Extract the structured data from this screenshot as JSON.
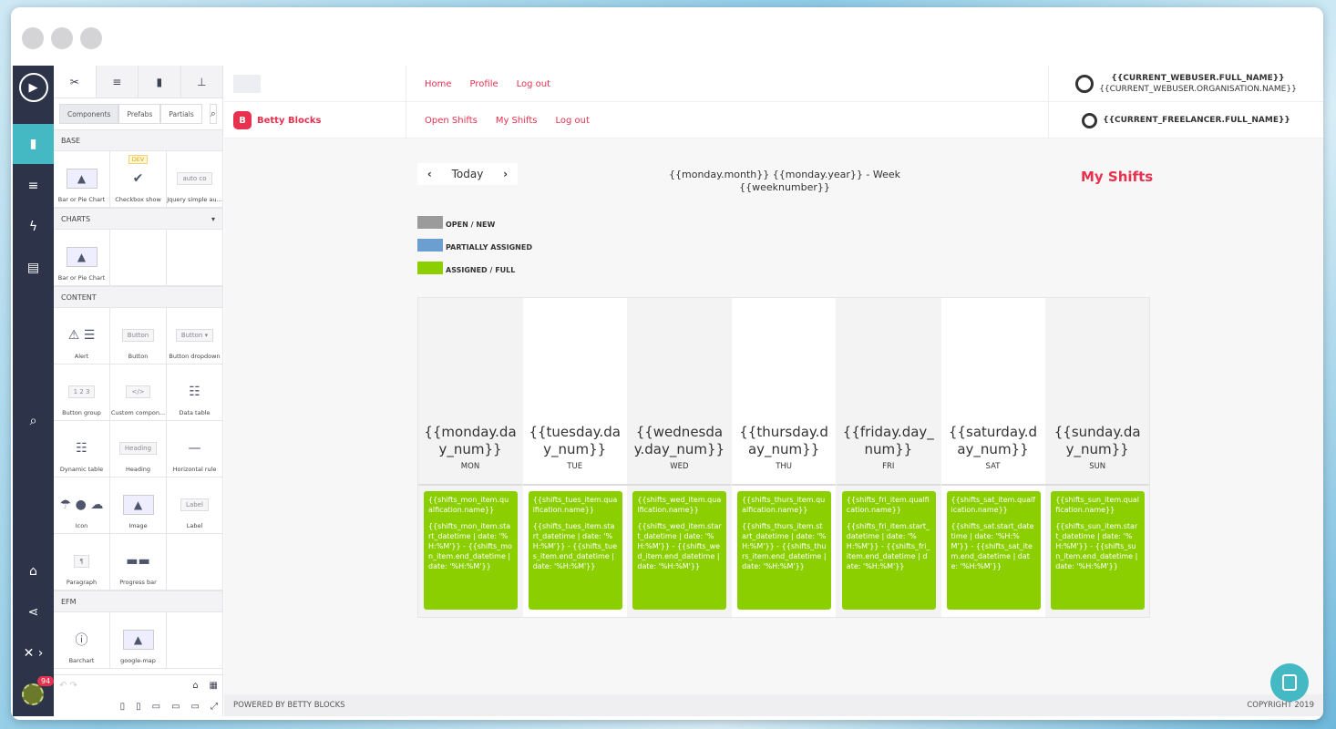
{
  "rail": {
    "icons": [
      "play-icon",
      "page-icon",
      "database-icon",
      "lightning-icon",
      "server-icon",
      "search-icon",
      "store-icon",
      "share-icon",
      "tools-icon"
    ],
    "notifications": "94"
  },
  "panel": {
    "segments": [
      "Components",
      "Prefabs",
      "Partials"
    ],
    "sections": [
      {
        "title": "BASE",
        "items": [
          {
            "label": "Bar or Pie Chart",
            "icon": "image-icon"
          },
          {
            "label": "Checkbox show",
            "icon": "checkbox-icon",
            "tag": "DEV"
          },
          {
            "label": "Jquery simple au...",
            "icon": "autocomplete-icon",
            "preview": "auto co"
          }
        ]
      },
      {
        "title": "CHARTS",
        "items": [
          {
            "label": "Bar or Pie Chart",
            "icon": "image-icon"
          }
        ]
      },
      {
        "title": "CONTENT",
        "items": [
          {
            "label": "Alert",
            "icon": "alert-icon"
          },
          {
            "label": "Button",
            "icon": "button-icon",
            "preview": "Button"
          },
          {
            "label": "Button dropdown",
            "icon": "button-dropdown-icon",
            "preview": "Button ▾"
          },
          {
            "label": "Button group",
            "icon": "button-group-icon",
            "preview": "1 2 3"
          },
          {
            "label": "Custom compon...",
            "icon": "code-icon",
            "preview": "</>"
          },
          {
            "label": "Data table",
            "icon": "table-icon"
          },
          {
            "label": "Dynamic table",
            "icon": "table-icon"
          },
          {
            "label": "Heading",
            "icon": "heading-icon",
            "preview": "Heading"
          },
          {
            "label": "Horizontal rule",
            "icon": "rule-icon"
          },
          {
            "label": "Icon",
            "icon": "icons-icon"
          },
          {
            "label": "Image",
            "icon": "image-icon"
          },
          {
            "label": "Label",
            "icon": "label-icon",
            "preview": "Label"
          },
          {
            "label": "Paragraph",
            "icon": "paragraph-icon",
            "preview": "¶"
          },
          {
            "label": "Progress bar",
            "icon": "progress-icon"
          }
        ]
      },
      {
        "title": "EFM",
        "items": [
          {
            "label": "Barchart",
            "icon": "info-icon"
          },
          {
            "label": "google-map",
            "icon": "image-icon"
          }
        ]
      }
    ]
  },
  "header": {
    "brand": "Betty Blocks",
    "nav1": [
      "Home",
      "Profile",
      "Log out"
    ],
    "nav2": [
      "Open Shifts",
      "My Shifts",
      "Log out"
    ],
    "webuser_name": "{{CURRENT_WEBUSER.FULL_NAME}}",
    "webuser_org": "{{CURRENT_WEBUSER.ORGANISATION.NAME}}",
    "freelancer_name": "{{CURRENT_FREELANCER.FULL_NAME}}"
  },
  "toolbar": {
    "today": "Today",
    "week_title": "{{monday.month}} {{monday.year}} - Week {{weeknumber}}",
    "page_title": "My Shifts"
  },
  "legend": [
    {
      "label": "OPEN / NEW",
      "color": "#9b9b9b"
    },
    {
      "label": "PARTIALLY ASSIGNED",
      "color": "#6c9fd1"
    },
    {
      "label": "ASSIGNED / FULL",
      "color": "#8ccf00"
    }
  ],
  "days": [
    {
      "num": "{{monday.day_num}}",
      "name": "MON",
      "q": "{{shifts_mon_item.qualfication.name}}",
      "t": "{{shifts_mon_item.start_datetime | date: '%H:%M'}} - {{shifts_mon_item.end_datetime | date: '%H:%M'}}"
    },
    {
      "num": "{{tuesday.day_num}}",
      "name": "TUE",
      "q": "{{shifts_tues_item.qualfication.name}}",
      "t": "{{shifts_tues_item.start_datetime | date: '%H:%M'}} - {{shifts_tues_item.end_datetime | date: '%H:%M'}}"
    },
    {
      "num": "{{wednesday.day_num}}",
      "name": "WED",
      "q": "{{shifts_wed_item.qualfication.name}}",
      "t": "{{shifts_wed_item.start_datetime | date: '%H:%M'}} - {{shifts_wed_item.end_datetime | date: '%H:%M'}}"
    },
    {
      "num": "{{thursday.day_num}}",
      "name": "THU",
      "q": "{{shifts_thurs_item.qualfication.name}}",
      "t": "{{shifts_thurs_item.start_datetime | date: '%H:%M'}} - {{shifts_thurs_item.end_datetime | date: '%H:%M'}}"
    },
    {
      "num": "{{friday.day_num}}",
      "name": "FRI",
      "q": "{{shifts_fri_item.qualfication.name}}",
      "t": "{{shifts_fri_item.start_datetime | date: '%H:%M'}} - {{shifts_fri_item.end_datetime | date: '%H:%M'}}"
    },
    {
      "num": "{{saturday.day_num}}",
      "name": "SAT",
      "q": "{{shifts_sat_item.qualfication.name}}",
      "t": "{{shifts_sat.start_datetime | date: '%H:%M'}} - {{shifts_sat_item.end_datetime | date: '%H:%M'}}"
    },
    {
      "num": "{{sunday.day_num}}",
      "name": "SUN",
      "q": "{{shifts_sun_item.qualfication.name}}",
      "t": "{{shifts_sun_item.start_datetime | date: '%H:%M'}} - {{shifts_sun_item.end_datetime | date: '%H:%M'}}"
    }
  ],
  "footer": {
    "left": "POWERED BY BETTY BLOCKS",
    "right": "COPYRIGHT 2019"
  },
  "colors": {
    "accent": "#e8304f",
    "rail": "#2d3348",
    "teal": "#44b8c3",
    "assigned": "#8ccf00"
  }
}
